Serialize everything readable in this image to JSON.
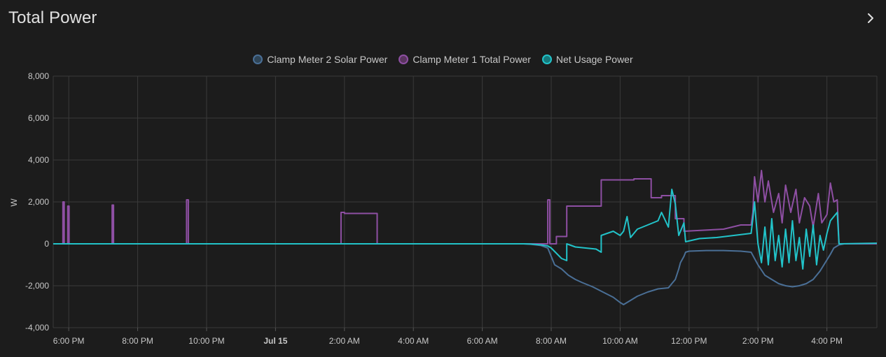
{
  "card": {
    "title": "Total Power",
    "more_icon": "chevron-right-icon"
  },
  "legend": [
    {
      "name": "Clamp Meter 2 Solar Power",
      "color": "#4a6f96"
    },
    {
      "name": "Clamp Meter 1 Total Power",
      "color": "#8e4fa3"
    },
    {
      "name": "Net Usage Power",
      "color": "#22c3c9"
    }
  ],
  "chart_data": {
    "type": "line",
    "ylabel": "W",
    "xlabel": "",
    "ylim": [
      -4000,
      8000
    ],
    "yticks": [
      "8,000",
      "6,000",
      "4,000",
      "2,000",
      "0",
      "-2,000",
      "-4,000"
    ],
    "ytick_values": [
      8000,
      6000,
      4000,
      2000,
      0,
      -2000,
      -4000
    ],
    "xlim_hours": [
      17.55,
      41.45
    ],
    "xticks": [
      {
        "label": "6:00 PM",
        "t": 18,
        "bold": false
      },
      {
        "label": "8:00 PM",
        "t": 20,
        "bold": false
      },
      {
        "label": "10:00 PM",
        "t": 22,
        "bold": false
      },
      {
        "label": "Jul 15",
        "t": 24,
        "bold": true
      },
      {
        "label": "2:00 AM",
        "t": 26,
        "bold": false
      },
      {
        "label": "4:00 AM",
        "t": 28,
        "bold": false
      },
      {
        "label": "6:00 AM",
        "t": 30,
        "bold": false
      },
      {
        "label": "8:00 AM",
        "t": 32,
        "bold": false
      },
      {
        "label": "10:00 AM",
        "t": 34,
        "bold": false
      },
      {
        "label": "12:00 PM",
        "t": 36,
        "bold": false
      },
      {
        "label": "2:00 PM",
        "t": 38,
        "bold": false
      },
      {
        "label": "4:00 PM",
        "t": 40,
        "bold": false
      }
    ],
    "grid": true,
    "legend_position": "top-center",
    "series": [
      {
        "name": "Clamp Meter 2 Solar Power",
        "color": "#4a6f96",
        "points": [
          [
            17.55,
            0
          ],
          [
            31.2,
            0
          ],
          [
            31.4,
            -20
          ],
          [
            31.7,
            -80
          ],
          [
            31.9,
            -200
          ],
          [
            32.0,
            -600
          ],
          [
            32.1,
            -1000
          ],
          [
            32.3,
            -1200
          ],
          [
            32.5,
            -1500
          ],
          [
            32.7,
            -1700
          ],
          [
            32.9,
            -1850
          ],
          [
            33.2,
            -2050
          ],
          [
            33.5,
            -2300
          ],
          [
            33.8,
            -2550
          ],
          [
            34.0,
            -2800
          ],
          [
            34.1,
            -2900
          ],
          [
            34.3,
            -2700
          ],
          [
            34.5,
            -2500
          ],
          [
            34.8,
            -2300
          ],
          [
            35.1,
            -2150
          ],
          [
            35.4,
            -2100
          ],
          [
            35.5,
            -1900
          ],
          [
            35.6,
            -1700
          ],
          [
            35.7,
            -1200
          ],
          [
            35.75,
            -900
          ],
          [
            35.85,
            -600
          ],
          [
            35.9,
            -400
          ],
          [
            36.0,
            -350
          ],
          [
            36.5,
            -320
          ],
          [
            37.0,
            -320
          ],
          [
            37.5,
            -350
          ],
          [
            37.8,
            -400
          ],
          [
            37.9,
            -700
          ],
          [
            38.0,
            -1000
          ],
          [
            38.2,
            -1500
          ],
          [
            38.4,
            -1700
          ],
          [
            38.6,
            -1900
          ],
          [
            38.8,
            -2000
          ],
          [
            39.0,
            -2050
          ],
          [
            39.2,
            -2000
          ],
          [
            39.4,
            -1900
          ],
          [
            39.6,
            -1700
          ],
          [
            39.8,
            -1300
          ],
          [
            39.95,
            -900
          ],
          [
            40.1,
            -500
          ],
          [
            40.2,
            -200
          ],
          [
            40.35,
            -50
          ],
          [
            40.5,
            0
          ],
          [
            41.45,
            0
          ]
        ]
      },
      {
        "name": "Clamp Meter 1 Total Power",
        "color": "#8e4fa3",
        "points": [
          [
            17.55,
            0
          ],
          [
            17.83,
            0
          ],
          [
            17.83,
            2000
          ],
          [
            17.87,
            2000
          ],
          [
            17.87,
            0
          ],
          [
            17.97,
            0
          ],
          [
            17.97,
            1800
          ],
          [
            18.01,
            1800
          ],
          [
            18.01,
            0
          ],
          [
            19.26,
            0
          ],
          [
            19.26,
            1850
          ],
          [
            19.3,
            1850
          ],
          [
            19.3,
            0
          ],
          [
            21.42,
            0
          ],
          [
            21.42,
            2100
          ],
          [
            21.47,
            2100
          ],
          [
            21.47,
            0
          ],
          [
            25.9,
            0
          ],
          [
            25.9,
            1500
          ],
          [
            26.0,
            1500
          ],
          [
            26.0,
            1450
          ],
          [
            26.95,
            1450
          ],
          [
            26.95,
            0
          ],
          [
            31.9,
            0
          ],
          [
            31.9,
            2100
          ],
          [
            31.96,
            2100
          ],
          [
            31.96,
            0
          ],
          [
            32.15,
            0
          ],
          [
            32.15,
            350
          ],
          [
            32.45,
            350
          ],
          [
            32.45,
            1800
          ],
          [
            33.45,
            1800
          ],
          [
            33.45,
            3050
          ],
          [
            34.4,
            3050
          ],
          [
            34.4,
            3100
          ],
          [
            34.9,
            3100
          ],
          [
            34.9,
            2200
          ],
          [
            35.2,
            2200
          ],
          [
            35.2,
            2300
          ],
          [
            35.6,
            2300
          ],
          [
            35.6,
            1200
          ],
          [
            35.85,
            1200
          ],
          [
            35.85,
            600
          ],
          [
            37.0,
            700
          ],
          [
            37.5,
            900
          ],
          [
            37.8,
            900
          ],
          [
            37.85,
            1500
          ],
          [
            37.9,
            3200
          ],
          [
            38.0,
            2000
          ],
          [
            38.1,
            3500
          ],
          [
            38.2,
            2000
          ],
          [
            38.3,
            3000
          ],
          [
            38.45,
            1500
          ],
          [
            38.6,
            2400
          ],
          [
            38.7,
            1000
          ],
          [
            38.8,
            2800
          ],
          [
            38.95,
            1500
          ],
          [
            39.1,
            2600
          ],
          [
            39.2,
            1000
          ],
          [
            39.35,
            2200
          ],
          [
            39.5,
            1800
          ],
          [
            39.6,
            800
          ],
          [
            39.75,
            2400
          ],
          [
            39.85,
            1000
          ],
          [
            40.0,
            1400
          ],
          [
            40.1,
            2900
          ],
          [
            40.2,
            2000
          ],
          [
            40.3,
            2100
          ],
          [
            40.35,
            0
          ],
          [
            41.45,
            0
          ]
        ]
      },
      {
        "name": "Net Usage Power",
        "color": "#22c3c9",
        "points": [
          [
            17.55,
            0
          ],
          [
            31.2,
            0
          ],
          [
            31.4,
            -10
          ],
          [
            31.7,
            -50
          ],
          [
            31.9,
            -100
          ],
          [
            32.0,
            -200
          ],
          [
            32.15,
            -450
          ],
          [
            32.3,
            -700
          ],
          [
            32.45,
            -800
          ],
          [
            32.45,
            0
          ],
          [
            32.7,
            -150
          ],
          [
            33.0,
            -200
          ],
          [
            33.3,
            -250
          ],
          [
            33.45,
            -400
          ],
          [
            33.45,
            400
          ],
          [
            33.8,
            600
          ],
          [
            34.0,
            400
          ],
          [
            34.1,
            600
          ],
          [
            34.2,
            1300
          ],
          [
            34.3,
            300
          ],
          [
            34.5,
            700
          ],
          [
            34.8,
            900
          ],
          [
            35.1,
            1100
          ],
          [
            35.2,
            1500
          ],
          [
            35.4,
            800
          ],
          [
            35.5,
            2600
          ],
          [
            35.6,
            1900
          ],
          [
            35.7,
            400
          ],
          [
            35.85,
            1000
          ],
          [
            35.9,
            100
          ],
          [
            36.3,
            250
          ],
          [
            36.8,
            300
          ],
          [
            37.3,
            400
          ],
          [
            37.8,
            500
          ],
          [
            37.85,
            1200
          ],
          [
            37.9,
            2000
          ],
          [
            38.0,
            0
          ],
          [
            38.1,
            -900
          ],
          [
            38.2,
            800
          ],
          [
            38.3,
            -1000
          ],
          [
            38.4,
            1200
          ],
          [
            38.5,
            -800
          ],
          [
            38.6,
            400
          ],
          [
            38.7,
            -1100
          ],
          [
            38.8,
            700
          ],
          [
            38.9,
            -900
          ],
          [
            39.0,
            1100
          ],
          [
            39.1,
            -800
          ],
          [
            39.2,
            300
          ],
          [
            39.3,
            -1200
          ],
          [
            39.4,
            700
          ],
          [
            39.5,
            -600
          ],
          [
            39.6,
            900
          ],
          [
            39.7,
            -1000
          ],
          [
            39.8,
            400
          ],
          [
            39.9,
            -300
          ],
          [
            40.0,
            500
          ],
          [
            40.1,
            1100
          ],
          [
            40.2,
            1300
          ],
          [
            40.3,
            1500
          ],
          [
            40.35,
            0
          ],
          [
            41.45,
            30
          ]
        ]
      }
    ]
  }
}
